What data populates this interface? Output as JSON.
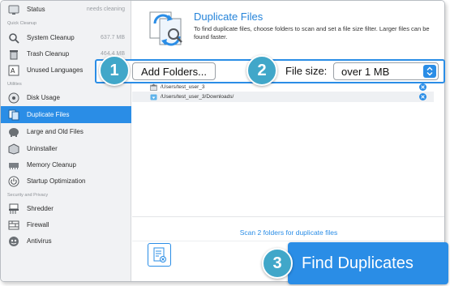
{
  "sidebar": {
    "items": [
      {
        "label": "Status",
        "value": "needs cleaning",
        "icon": "status-icon"
      },
      {
        "label": "System Cleanup",
        "value": "637.7 MB",
        "icon": "system-cleanup-icon"
      },
      {
        "label": "Trash Cleanup",
        "value": "464.4 MB",
        "icon": "trash-icon"
      },
      {
        "label": "Unused Languages",
        "value": "",
        "icon": "languages-icon"
      },
      {
        "label": "Disk Usage",
        "value": "",
        "icon": "disk-usage-icon"
      },
      {
        "label": "Duplicate Files",
        "value": "",
        "icon": "duplicate-files-icon"
      },
      {
        "label": "Large and Old Files",
        "value": "",
        "icon": "elephant-icon"
      },
      {
        "label": "Uninstaller",
        "value": "",
        "icon": "uninstaller-icon"
      },
      {
        "label": "Memory Cleanup",
        "value": "",
        "icon": "memory-icon"
      },
      {
        "label": "Startup Optimization",
        "value": "",
        "icon": "power-icon"
      },
      {
        "label": "Shredder",
        "value": "",
        "icon": "shredder-icon"
      },
      {
        "label": "Firewall",
        "value": "",
        "icon": "firewall-icon"
      },
      {
        "label": "Antivirus",
        "value": "",
        "icon": "antivirus-icon"
      }
    ],
    "sections": [
      "Quick Cleanup",
      "Utilities",
      "Security and Privacy"
    ]
  },
  "main": {
    "title": "Duplicate Files",
    "description": "To find duplicate files, choose folders to scan and set a file size filter. Larger files can be found faster.",
    "add_folders_label": "Add Folders...",
    "file_size_label": "File size:",
    "file_size_value": "over 1 MB",
    "folders": [
      "/Users/test_user_3",
      "/Users/test_user_3/Downloads/"
    ],
    "scan_link": "Scan 2 folders for duplicate files",
    "find_button": "Find Duplicates"
  },
  "callouts": [
    "1",
    "2",
    "3"
  ],
  "colors": {
    "accent": "#2a8de6",
    "badge": "#41a7c9",
    "sidebar_bg": "#f1f2f4"
  }
}
